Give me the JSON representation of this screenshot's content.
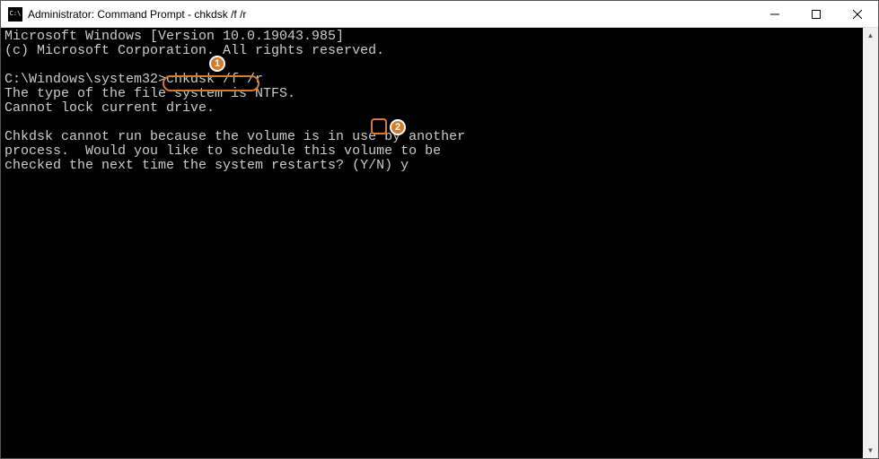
{
  "titlebar": {
    "icon_text": "C:\\",
    "title": "Administrator: Command Prompt - chkdsk  /f /r"
  },
  "terminal": {
    "line1": "Microsoft Windows [Version 10.0.19043.985]",
    "line2": "(c) Microsoft Corporation. All rights reserved.",
    "blank1": " ",
    "prompt_prefix": "C:\\Windows\\system32>",
    "command": "chkdsk /f /r",
    "line4": "The type of the file system is NTFS.",
    "line5": "Cannot lock current drive.",
    "blank2": " ",
    "line6": "Chkdsk cannot run because the volume is in use by another",
    "line7": "process.  Would you like to schedule this volume to be",
    "line8_prefix": "checked the next time the system restarts? (Y/N) ",
    "response": "y"
  },
  "annotations": {
    "badge1": "1",
    "badge2": "2"
  }
}
